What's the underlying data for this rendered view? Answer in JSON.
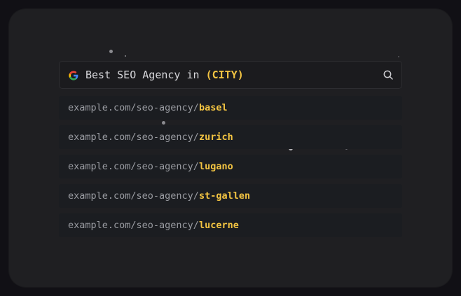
{
  "search": {
    "query_prefix": "Best SEO Agency in ",
    "query_city": "(CITY)",
    "engine_icon": "google-g-icon",
    "action_icon": "search-icon"
  },
  "results": [
    {
      "base": "example.com/seo-agency/",
      "slug": "basel"
    },
    {
      "base": "example.com/seo-agency/",
      "slug": "zurich"
    },
    {
      "base": "example.com/seo-agency/",
      "slug": "lugano"
    },
    {
      "base": "example.com/seo-agency/",
      "slug": "st-gallen"
    },
    {
      "base": "example.com/seo-agency/",
      "slug": "lucerne"
    }
  ],
  "colors": {
    "accent": "#f3c442",
    "card": "#1f1f22",
    "background": "#111015"
  }
}
